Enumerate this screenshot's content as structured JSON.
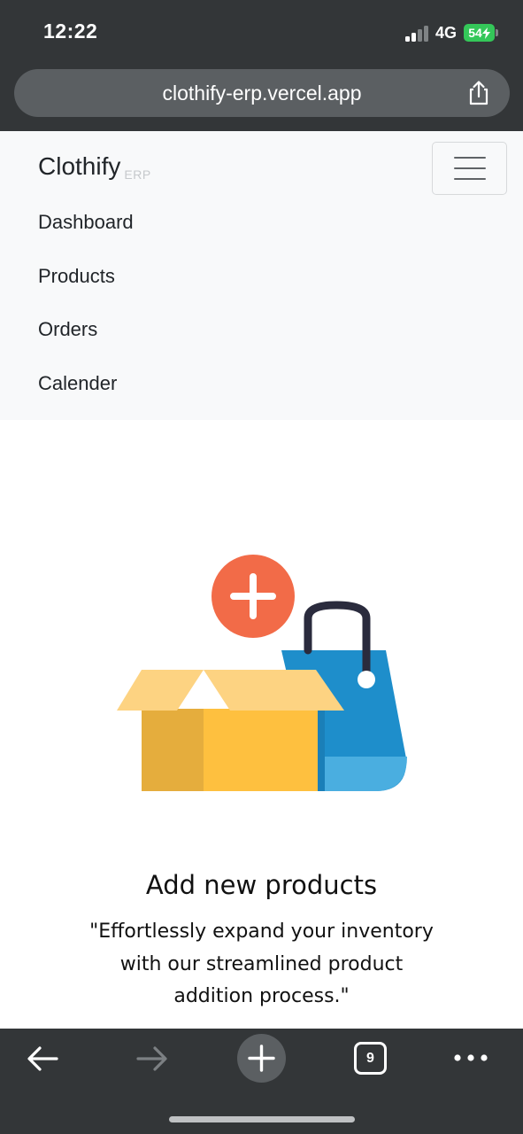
{
  "status_bar": {
    "time": "12:22",
    "network": "4G",
    "battery": "54"
  },
  "browser": {
    "url": "clothify-erp.vercel.app",
    "tab_count": "9",
    "icons": {
      "share": "share-icon",
      "back": "back-arrow-icon",
      "forward": "forward-arrow-icon",
      "new_tab": "plus-icon",
      "more": "more-dots-icon"
    }
  },
  "navbar": {
    "brand": "Clothify",
    "brand_sub": "ERP",
    "items": [
      {
        "label": "Dashboard"
      },
      {
        "label": "Products"
      },
      {
        "label": "Orders"
      },
      {
        "label": "Calender"
      }
    ],
    "toggler_icon": "hamburger-icon"
  },
  "hero": {
    "illustration": "add-product-illustration",
    "title": "Add new products",
    "description": "\"Effortlessly expand your inventory with our streamlined product addition process.\""
  },
  "colors": {
    "chrome_bg": "#333638",
    "url_bar_bg": "#5b5f62",
    "navbar_bg": "#f8f9fa",
    "battery_green": "#34c759",
    "plus_orange": "#f26b48",
    "box_yellow": "#fec03f",
    "bag_blue": "#1e8ecb"
  }
}
